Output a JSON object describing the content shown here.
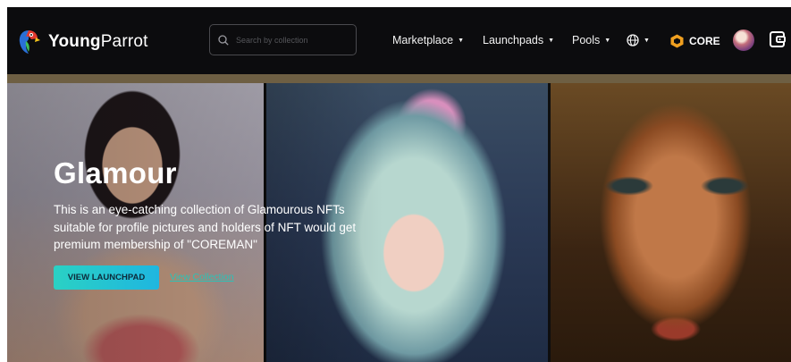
{
  "header": {
    "brand_bold": "Young",
    "brand_rest": "Parrot",
    "search_placeholder": "Search by collection",
    "nav": [
      {
        "label": "Marketplace"
      },
      {
        "label": "Launchpads"
      },
      {
        "label": "Pools"
      }
    ],
    "language_icon": "globe-icon",
    "network_label": "CORE",
    "network_icon": "core-hexagon-icon",
    "wallet_icon": "wallet-icon"
  },
  "hero": {
    "title": "Glamour",
    "description": "This is an eye-catching collection of Glamourous NFTs suitable for profile pictures and holders of NFT would get premium membership of \"COREMAN\"",
    "primary_button": "VIEW LAUNCHPAD",
    "secondary_link": "View Collection"
  },
  "colors": {
    "navbar_bg": "#0c0c0e",
    "accent_teal": "#28c3b8",
    "core_orange": "#f0a020",
    "strip": "#6e5f43"
  }
}
